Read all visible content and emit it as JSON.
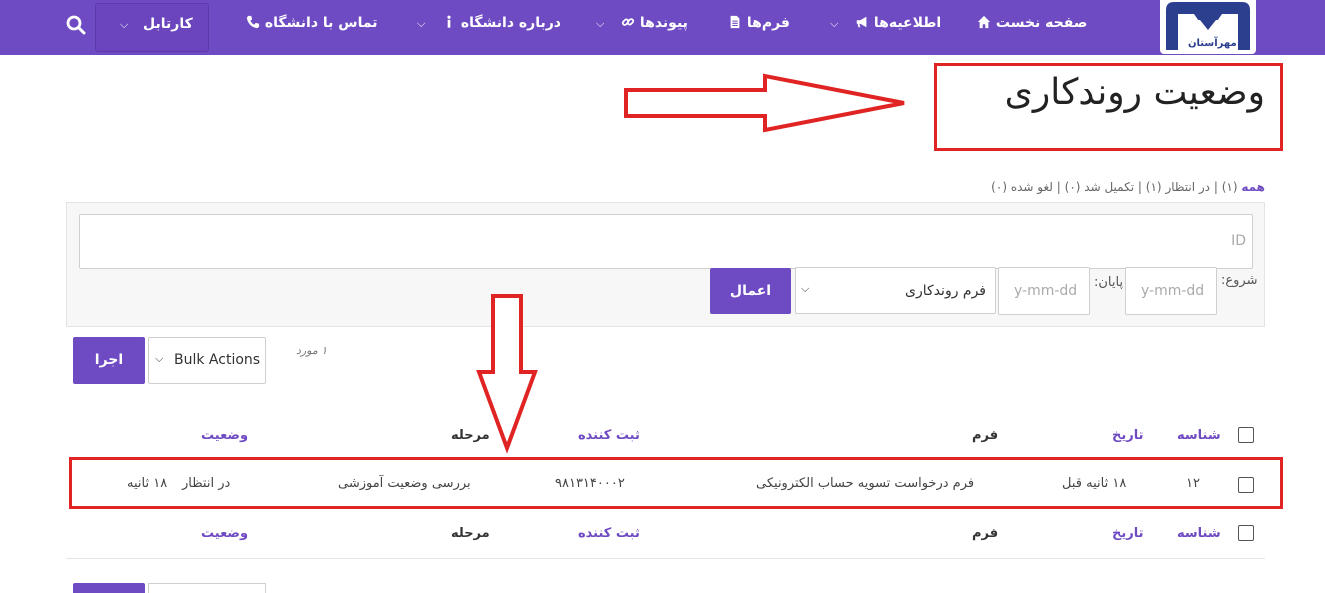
{
  "nav": {
    "home": "صفحه نخست",
    "announcements": "اطلاعیه‌ها",
    "forms": "فرم‌ها",
    "links": "پیوندها",
    "about": "درباره دانشگاه",
    "contact": "تماس با دانشگاه",
    "kartabl": "کارتابل",
    "logo_text": "مهرآستان"
  },
  "page": {
    "title": "وضعیت روندکاری"
  },
  "status_filters": {
    "all": "همه",
    "all_count": "(۱)",
    "pending": "در انتظار",
    "pending_count": "(۱)",
    "completed": "تکمیل شد",
    "completed_count": "(۰)",
    "cancelled": "لغو شده",
    "cancelled_count": "(۰)",
    "separator": "|"
  },
  "filters": {
    "id_placeholder": "ID",
    "start_label": "شروع:",
    "end_label": "پایان:",
    "start_placeholder": "y-mm-dd",
    "end_placeholder": "y-mm-dd",
    "form_select_value": "فرم روندکاری",
    "apply_button": "اعمال"
  },
  "bulk": {
    "select_value": "Bulk Actions",
    "run_button": "اجرا",
    "items_count": "۱ مورد"
  },
  "table": {
    "columns": {
      "id": "شناسه",
      "date": "تاریخ",
      "form": "فرم",
      "registrar": "ثبت کننده",
      "stage": "مرحله",
      "status": "وضعیت"
    },
    "rows": [
      {
        "id": "۱۲",
        "date": "۱۸ ثانیه قبل",
        "form": "فرم درخواست تسویه حساب الکترونیکی",
        "registrar": "۹۸۱۳۱۴۰۰۰۲",
        "stage": "بررسی وضعیت آموزشی",
        "status": "در انتظار",
        "status_time": "۱۸ ثانیه"
      }
    ]
  },
  "colors": {
    "brand": "#6f4bc3",
    "annotation": "#e02424"
  }
}
